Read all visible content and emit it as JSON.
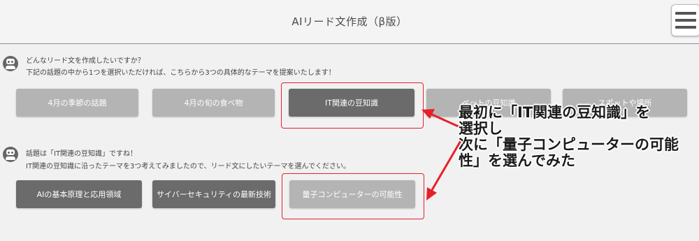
{
  "header": {
    "title": "AIリード文作成（β版）"
  },
  "chat": [
    {
      "line1": "どんなリード文を作成したいですか？",
      "line2": "下記の話題の中から1つを選択いただければ、こちらから3つの具体的なテーマを提案いたします！"
    },
    {
      "line1": "話題は「IT関連の豆知識」ですね！",
      "line2": "IT関連の豆知識に沿ったテーマを3つ考えてみましたので、リード文にしたいテーマを選んでください。"
    }
  ],
  "topics": [
    {
      "label": "4月の季節の話題"
    },
    {
      "label": "4月の旬の食べ物"
    },
    {
      "label": "IT関連の豆知識"
    },
    {
      "label": "ペットの豆知識"
    },
    {
      "label": "スポットや場所"
    }
  ],
  "themes": [
    {
      "label": "AIの基本原理と応用領域"
    },
    {
      "label": "サイバーセキュリティの最新技術"
    },
    {
      "label": "量子コンピューターの可能性"
    }
  ],
  "annotation": {
    "line1": "最初に「IT関連の豆知識」を",
    "line2": "選択し",
    "line3": "次に「量子コンピューターの可能",
    "line4": "性」を選んでみた"
  },
  "colors": {
    "accent_red": "#e8202a",
    "button_dark": "#6b6b6b",
    "button_light": "#b4b4b4"
  }
}
